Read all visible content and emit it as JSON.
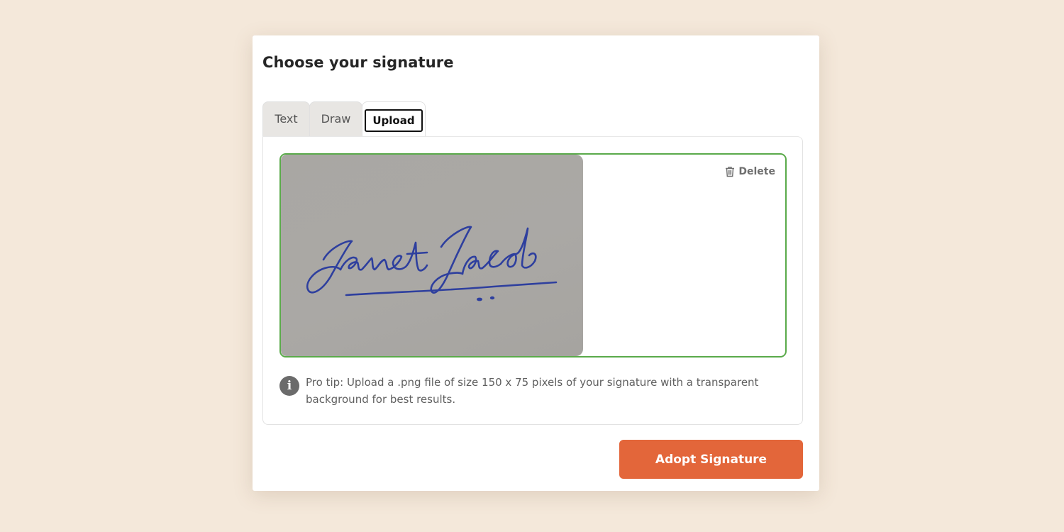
{
  "modal": {
    "title": "Choose your signature"
  },
  "tabs": {
    "text": "Text",
    "draw": "Draw",
    "upload": "Upload",
    "active": "Upload"
  },
  "upload": {
    "delete_label": "Delete",
    "delete_icon": "trash-icon",
    "signature_image": "uploaded handwritten signature photo",
    "border_color": "#5aaa4a"
  },
  "tip": {
    "icon": "info-icon",
    "text": "Pro tip: Upload a .png file of size 150 x 75 pixels of your signature with a transparent background for best results."
  },
  "actions": {
    "adopt_label": "Adopt Signature",
    "adopt_color": "#e3663a"
  }
}
